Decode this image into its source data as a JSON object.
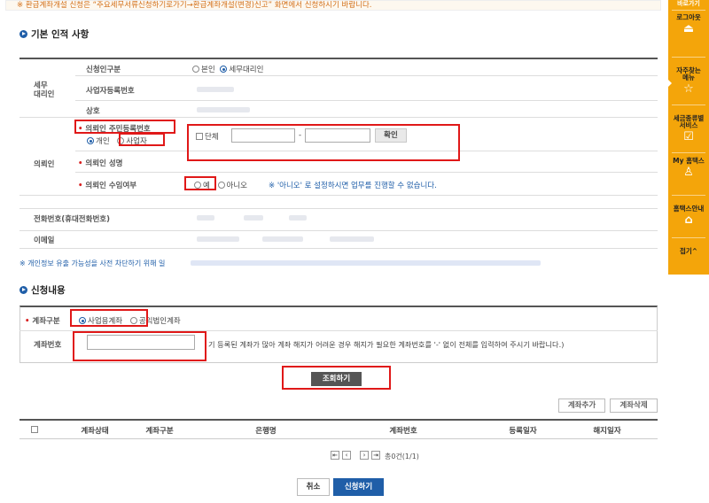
{
  "notice": "※ 환급계좌개설 신청은 “주요세무서류신청하기로가기→환급계좌개설(변경)신고” 화면에서 신청하시기 바랍니다.",
  "basic_section": {
    "title": "기본 인적 사항",
    "applicant_type_label": "신청인구분",
    "applicant_options": [
      "본인",
      "세무대리인"
    ],
    "selected_applicant": "세무대리인",
    "tax_agent_group": "세무\n대리인",
    "business_number_label": "사업자등록번호",
    "trade_name_label": "상호",
    "client_group": "의뢰인",
    "client_id_label": "의뢰인 주민등록번호",
    "client_kind_options": [
      "개인",
      "사업자"
    ],
    "selected_client_kind": "개인",
    "group_checkbox_label": "단체",
    "id_separator": "-",
    "confirm_button": "확인",
    "client_name_label": "의뢰인 성명",
    "client_consent_label": "의뢰인 수임여부",
    "consent_options": [
      "예",
      "아니오"
    ],
    "consent_note": "※ '아니오' 로 설정하시면 업무를 진행할 수 없습니다.",
    "phone_label": "전화번호(휴대전화번호)",
    "email_label": "이메일",
    "privacy_note": "※ 개인정보 유출 가능성을 사전 차단하기 위해 일"
  },
  "application_section": {
    "title": "신청내용",
    "account_type_label": "계좌구분",
    "account_type_options": [
      "사업용계좌",
      "공익법인계좌"
    ],
    "selected_account_type": "사업용계좌",
    "account_number_label": "계좌번호",
    "account_number_value": "",
    "account_hint": "기 등록된 계좌가 많아 계좌 해지가 어려운 경우 해지가 필요한 계좌번호를 '-' 없이 전체를 입력하여 주시기 바랍니다.)",
    "search_button": "조회하기",
    "add_account_button": "계좌추가",
    "delete_account_button": "계좌삭제",
    "table_headers": [
      "계좌상태",
      "계좌구분",
      "은행명",
      "계좌번호",
      "등록일자",
      "해지일자"
    ],
    "pager_text": "총0건(1/1)",
    "cancel_button": "취소",
    "submit_button": "신청하기"
  },
  "sidebar": {
    "top_label": "바로가기",
    "items": [
      {
        "label": "로그아웃",
        "icon": "logout-icon"
      },
      {
        "label": "자주찾는\n메뉴",
        "icon": "star-icon"
      },
      {
        "label": "세금종류별\n서비스",
        "icon": "check-icon"
      },
      {
        "label": "My 홈택스",
        "icon": "user-icon"
      },
      {
        "label": "홈택스안내",
        "icon": "home-icon"
      }
    ],
    "collapse_label": "접기^"
  },
  "colors": {
    "brand_blue": "#1f5ea8",
    "sidebar_orange": "#f4a50a",
    "highlight_red": "#e01818",
    "notice_orange": "#d3701a"
  }
}
